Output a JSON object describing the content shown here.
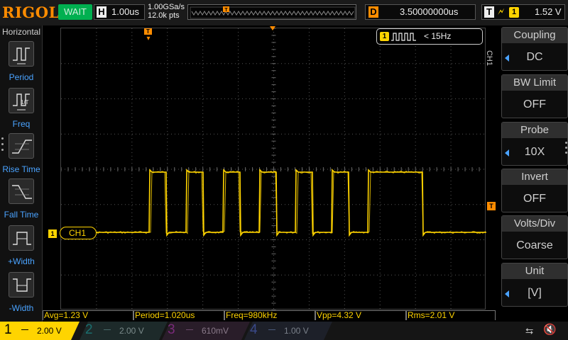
{
  "app": {
    "brand": "RIGOL",
    "run_status": "WAIT",
    "colors": {
      "ch1": "#ffd400",
      "ch2": "#00c8c8",
      "ch3": "#d040d0",
      "ch4": "#3070ff",
      "trigger": "#ff8c00",
      "accent": "#4aa3ff",
      "status": "#00b050"
    }
  },
  "timebase": {
    "letter": "H",
    "scale": "1.00us"
  },
  "acquisition": {
    "sample_rate": "1.00GSa/s",
    "mem_depth": "12.0k pts"
  },
  "delay": {
    "letter": "D",
    "value": "3.50000000us"
  },
  "trigger": {
    "letter": "T",
    "edge_icon": "rising-edge-icon",
    "source": "1",
    "level": "1.52 V"
  },
  "left_menu": {
    "title": "Horizontal",
    "items": [
      {
        "label": "Period",
        "icon": "period-icon"
      },
      {
        "label": "Freq",
        "icon": "freq-icon"
      },
      {
        "label": "Rise Time",
        "icon": "rise-time-icon"
      },
      {
        "label": "Fall Time",
        "icon": "fall-time-icon"
      },
      {
        "label": "+Width",
        "icon": "plus-width-icon"
      },
      {
        "label": "-Width",
        "icon": "minus-width-icon"
      }
    ]
  },
  "screen": {
    "ch1_marker": "1",
    "ch1_tag": "CH1",
    "trigger_position_marker": "T",
    "trigger_level_marker": "T",
    "freq_counter": {
      "source": "1",
      "value": "< 15Hz"
    }
  },
  "right_menu": {
    "side_label": "CH1",
    "items": [
      {
        "title": "Coupling",
        "value": "DC"
      },
      {
        "title": "BW Limit",
        "value": "OFF"
      },
      {
        "title": "Probe",
        "value": "10X"
      },
      {
        "title": "Invert",
        "value": "OFF"
      },
      {
        "title": "Volts/Div",
        "value": "Coarse"
      },
      {
        "title": "Unit",
        "value": "[V]"
      }
    ]
  },
  "measurements": [
    {
      "label": "Avg=1.23 V"
    },
    {
      "label": "Period=1.020us"
    },
    {
      "label": "Freq=980kHz"
    },
    {
      "label": "Vpp=4.32 V"
    },
    {
      "label": "Rms=2.01 V"
    }
  ],
  "channels": [
    {
      "num": "1",
      "scale": "2.00 V"
    },
    {
      "num": "2",
      "scale": "2.00 V"
    },
    {
      "num": "3",
      "scale": "610mV"
    },
    {
      "num": "4",
      "scale": "1.00 V"
    }
  ]
}
